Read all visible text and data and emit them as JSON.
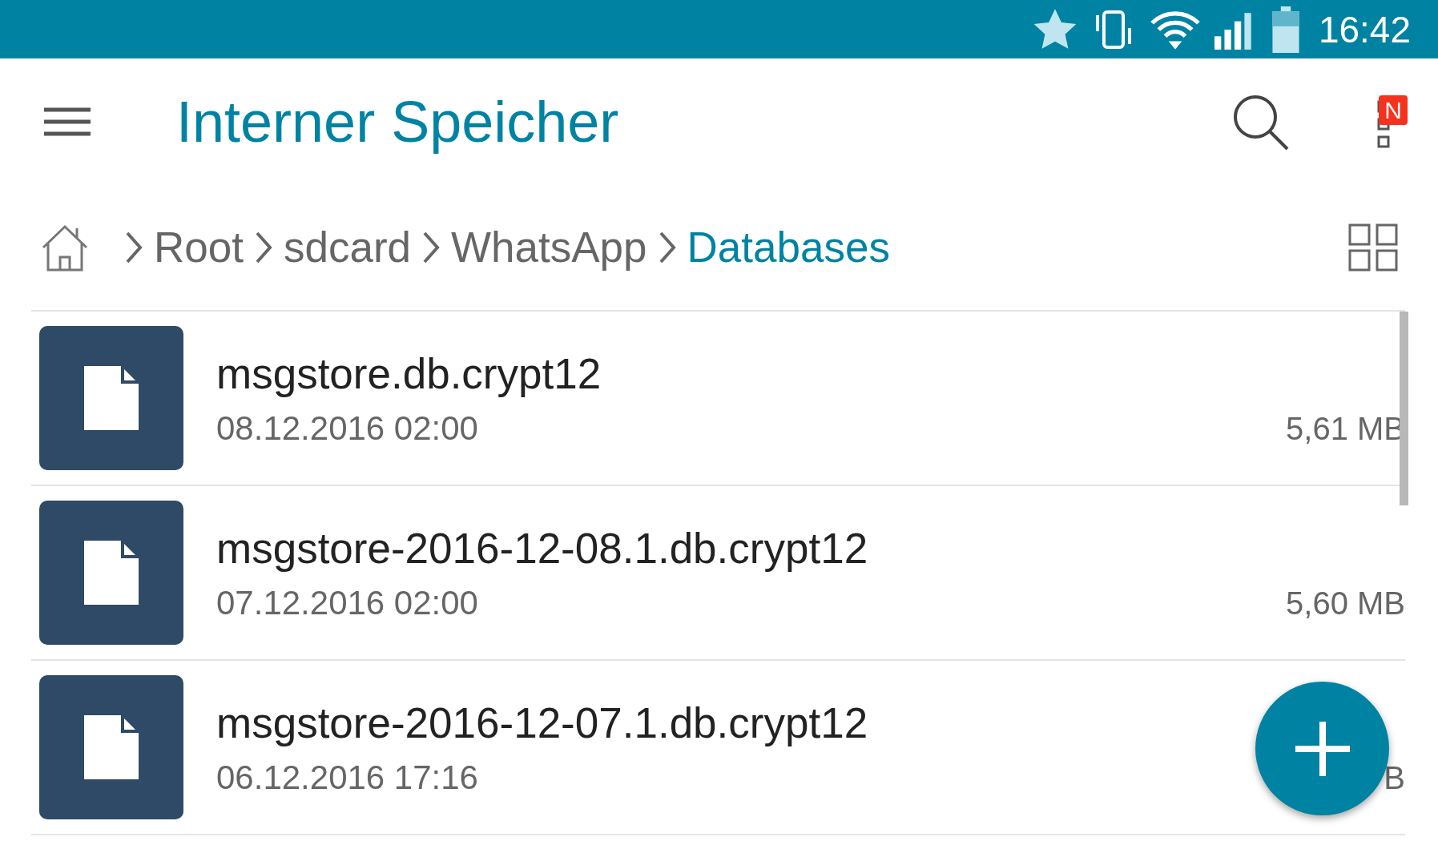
{
  "status_bar": {
    "time": "16:42"
  },
  "app_bar": {
    "title": "Interner Speicher",
    "badge": "N"
  },
  "breadcrumb": [
    {
      "label": "Root",
      "selected": false
    },
    {
      "label": "sdcard",
      "selected": false
    },
    {
      "label": "WhatsApp",
      "selected": false
    },
    {
      "label": "Databases",
      "selected": true
    }
  ],
  "files": [
    {
      "name": "msgstore.db.crypt12",
      "date": "08.12.2016 02:00",
      "size": "5,61 MB"
    },
    {
      "name": "msgstore-2016-12-08.1.db.crypt12",
      "date": "07.12.2016 02:00",
      "size": "5,60 MB"
    },
    {
      "name": "msgstore-2016-12-07.1.db.crypt12",
      "date": "06.12.2016 17:16",
      "size": "B"
    }
  ]
}
